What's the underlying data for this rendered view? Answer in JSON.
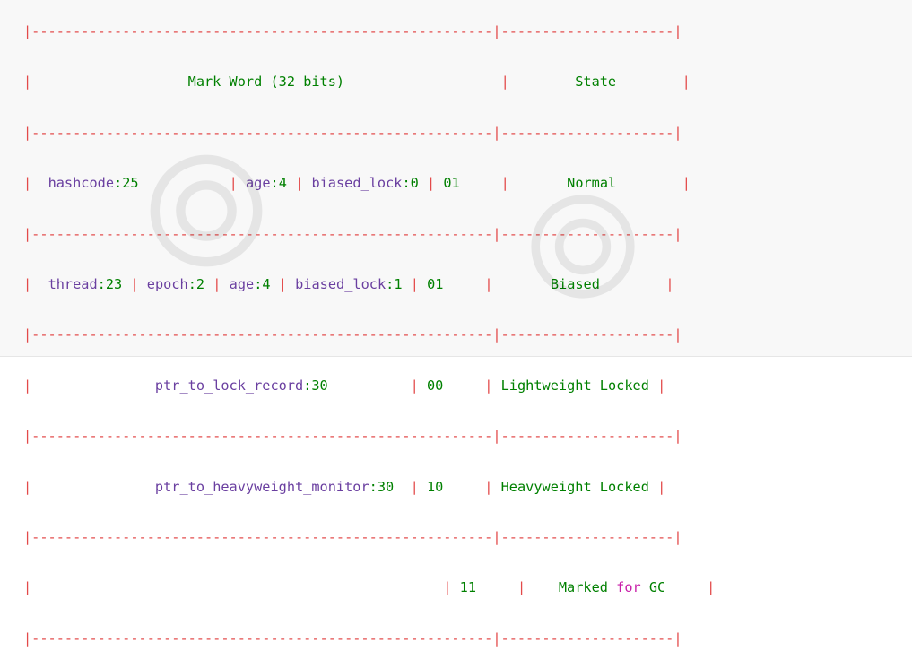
{
  "header": {
    "title_a": "Mark Word (",
    "title_num": "32",
    "title_b": " bits)",
    "state": "State"
  },
  "rows": [
    {
      "fields": [
        {
          "name": "hashcode",
          "sep": ":",
          "num": "25",
          "pad": "           "
        },
        {
          "name": "age",
          "sep": ":",
          "num": "4",
          "pad": " "
        },
        {
          "name": "biased_lock",
          "sep": ":",
          "num": "0",
          "pad": " "
        }
      ],
      "bits": "01",
      "state": "Normal"
    },
    {
      "fields": [
        {
          "name": "thread",
          "sep": ":",
          "num": "23",
          "pad": " "
        },
        {
          "name": "epoch",
          "sep": ":",
          "num": "2",
          "pad": " "
        },
        {
          "name": "age",
          "sep": ":",
          "num": "4",
          "pad": " "
        },
        {
          "name": "biased_lock",
          "sep": ":",
          "num": "1",
          "pad": " "
        }
      ],
      "bits": "01",
      "state": "Biased"
    },
    {
      "pointer": "ptr_to_lock_record",
      "pointer_sep": ":",
      "pointer_num": "30",
      "bits": "00",
      "state": "Lightweight Locked"
    },
    {
      "pointer": "ptr_to_heavyweight_monitor",
      "pointer_sep": ":",
      "pointer_num": "30",
      "bits": "10",
      "state": "Heavyweight Locked"
    },
    {
      "bits": "11",
      "state_a": "Marked ",
      "state_kw": "for",
      "state_b": " GC"
    }
  ]
}
